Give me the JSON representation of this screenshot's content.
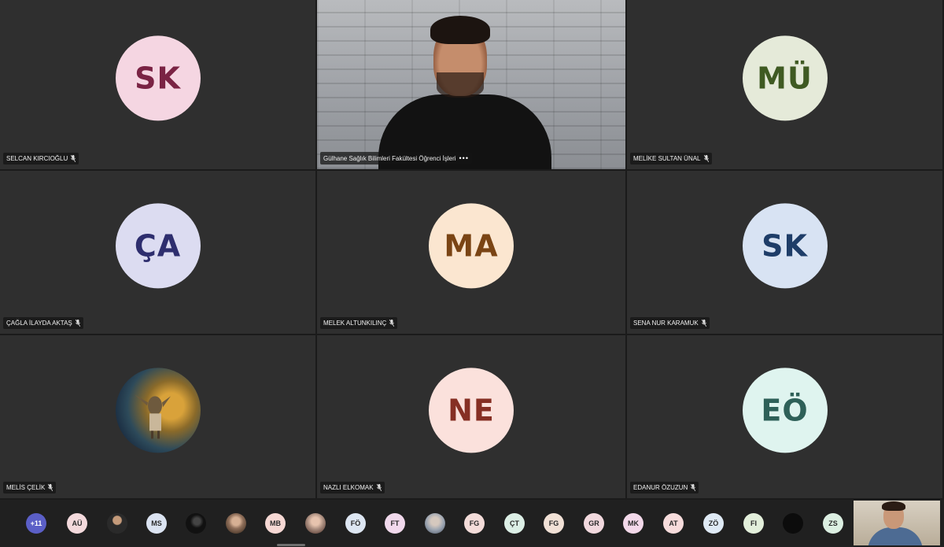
{
  "participants": [
    {
      "initials": "SK",
      "name": "SELCAN KIRCIOĞLU",
      "bg": "#f5d6e2",
      "fg": "#7a2344"
    },
    {
      "initials": "",
      "name": "Gülhane Sağlık Bilimleri Fakültesi Öğrenci İşleri",
      "video": true,
      "more": "•••"
    },
    {
      "initials": "MÜ",
      "name": "MELİKE SULTAN ÜNAL",
      "bg": "#e5ead9",
      "fg": "#3f5a22"
    },
    {
      "initials": "ÇA",
      "name": "ÇAĞLA İLAYDA AKTAŞ",
      "bg": "#dcdcf1",
      "fg": "#2e2e6e"
    },
    {
      "initials": "MA",
      "name": "MELEK ALTUNKILINÇ",
      "bg": "#fbe6d0",
      "fg": "#7a4414"
    },
    {
      "initials": "SK",
      "name": "SENA NUR KARAMUK",
      "bg": "#d8e3f3",
      "fg": "#1e3d68"
    },
    {
      "initials": "",
      "name": "MELİS ÇELİK",
      "photo": true
    },
    {
      "initials": "NE",
      "name": "NAZLI ELKOMAK",
      "bg": "#fbe1dc",
      "fg": "#862f24"
    },
    {
      "initials": "EÖ",
      "name": "EDANUR ÖZUZUN",
      "bg": "#dff4ef",
      "fg": "#2e6058"
    }
  ],
  "overflow_count": "+11",
  "chips": [
    {
      "label": "AÜ",
      "bg": "#f3d9dc"
    },
    {
      "label": "",
      "bg": "#3a3a3a",
      "photo": true
    },
    {
      "label": "MS",
      "bg": "#dbe3f1"
    },
    {
      "label": "",
      "bg": "#111111",
      "photo": true
    },
    {
      "label": "",
      "bg": "#8f6f5a",
      "photo": true
    },
    {
      "label": "MB",
      "bg": "#f6d8d4"
    },
    {
      "label": "",
      "bg": "#a78b7d",
      "photo": true
    },
    {
      "label": "FÖ",
      "bg": "#dde6f2"
    },
    {
      "label": "FT",
      "bg": "#f1d9ec"
    },
    {
      "label": "",
      "bg": "#9aa3b0",
      "photo": true
    },
    {
      "label": "FG",
      "bg": "#f3dcd9"
    },
    {
      "label": "ÇT",
      "bg": "#dcefe6"
    },
    {
      "label": "FG",
      "bg": "#f1e1d6"
    },
    {
      "label": "GR",
      "bg": "#f2d9de"
    },
    {
      "label": "MK",
      "bg": "#f3d9ea"
    },
    {
      "label": "AT",
      "bg": "#f7dcdc"
    },
    {
      "label": "ZÖ",
      "bg": "#dfeaf5"
    },
    {
      "label": "FI",
      "bg": "#e3efdb"
    },
    {
      "label": "",
      "bg": "#0c0c0c",
      "photo": true
    },
    {
      "label": "ZS",
      "bg": "#dcefe2"
    }
  ]
}
